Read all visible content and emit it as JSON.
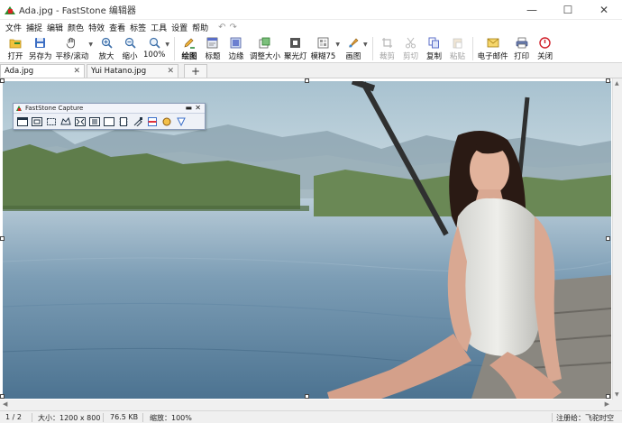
{
  "window": {
    "title": "Ada.jpg - FastStone 编辑器",
    "min_glyph": "—",
    "max_glyph": "☐",
    "close_glyph": "✕"
  },
  "menu": [
    "文件",
    "捕捉",
    "编辑",
    "颜色",
    "特效",
    "查看",
    "标签",
    "工具",
    "设置",
    "帮助"
  ],
  "undo_glyphs": {
    "undo": "↶",
    "redo": "↷"
  },
  "toolbar": {
    "open": "打开",
    "save_as": "另存为",
    "pan": "平移/滚动",
    "zoom_in": "放大",
    "zoom_out": "缩小",
    "zoom_level": "100%",
    "draw": "绘图",
    "caption": "标题",
    "edge": "边缘",
    "resize": "调整大小",
    "spotlight": "聚光灯",
    "blur": "模糊75",
    "paint": "画图",
    "crop": "裁剪",
    "cut": "剪切",
    "copy": "复制",
    "paste": "粘贴",
    "email": "电子邮件",
    "print": "打印",
    "close": "关闭"
  },
  "tabs": [
    {
      "label": "Ada.jpg",
      "active": true
    },
    {
      "label": "Yui Hatano.jpg",
      "active": false
    }
  ],
  "tab_add_glyph": "+",
  "tab_close_glyph": "✕",
  "capture_toolbar": {
    "title": "FastStone Capture",
    "min_glyph": "▬",
    "close_glyph": "✕"
  },
  "status": {
    "page": "1 / 2",
    "size": "大小：1200 x 800",
    "file_size": "76.5 KB",
    "zoom": "缩放：100%",
    "registered": "注册给：飞驼时空"
  },
  "colors": {
    "accent": "#1e5fb3",
    "sky_top": "#cfdde4",
    "water": "#6f93ad",
    "reeds": "#5e7a4a",
    "swimsuit": "#e4e4e0",
    "hair": "#2a1a14",
    "skin": "#d9a892"
  }
}
